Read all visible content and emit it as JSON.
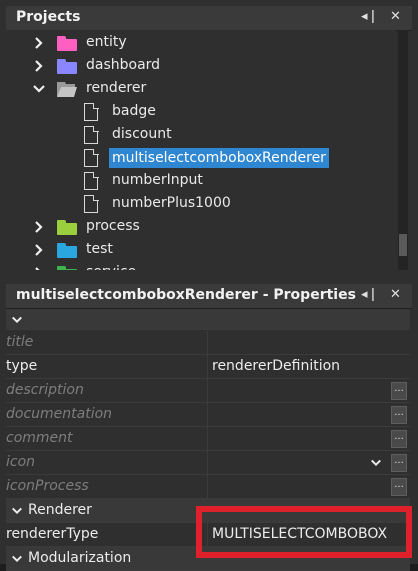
{
  "projects_panel": {
    "title": "Projects",
    "minimize_label": "◂",
    "close_label": "✕",
    "tree": [
      {
        "label": "entity",
        "color": "#ff5fc1"
      },
      {
        "label": "dashboard",
        "color": "#8a86ff"
      },
      {
        "label": "renderer",
        "color": "#bdbdbd"
      },
      {
        "label": "badge"
      },
      {
        "label": "discount"
      },
      {
        "label": "multiselectcomboboxRenderer"
      },
      {
        "label": "numberInput"
      },
      {
        "label": "numberPlus1000"
      },
      {
        "label": "process",
        "color": "#9ccf3e"
      },
      {
        "label": "test",
        "color": "#2aa7de"
      },
      {
        "label": "service",
        "color": "#3fb34f"
      }
    ]
  },
  "properties_panel": {
    "title": "multiselectcomboboxRenderer - Properties",
    "minimize_label": "◂",
    "close_label": "✕",
    "rows": [
      {
        "name": "title",
        "value": ""
      },
      {
        "name": "type",
        "value": "rendererDefinition"
      },
      {
        "name": "description",
        "value": ""
      },
      {
        "name": "documentation",
        "value": ""
      },
      {
        "name": "comment",
        "value": ""
      },
      {
        "name": "icon",
        "value": ""
      },
      {
        "name": "iconProcess",
        "value": ""
      }
    ],
    "group_renderer": "Renderer",
    "renderer_type": {
      "name": "rendererType",
      "value": "MULTISELECTCOMBOBOX"
    },
    "group_modularization": "Modularization",
    "more_button": "..."
  }
}
